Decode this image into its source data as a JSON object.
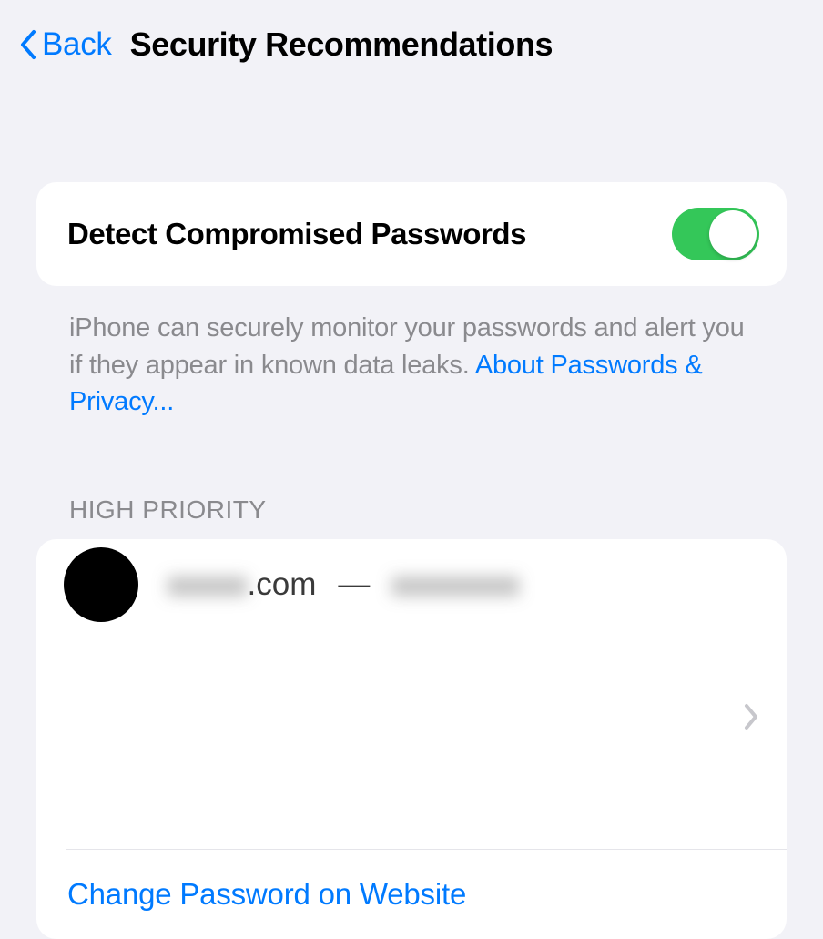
{
  "nav": {
    "back_label": "Back",
    "title": "Security Recommendations"
  },
  "detect_toggle": {
    "label": "Detect Compromised Passwords",
    "enabled": true
  },
  "description": {
    "text": "iPhone can securely monitor your passwords and alert you if they appear in known data leaks. ",
    "link_text": "About Passwords & Privacy..."
  },
  "section_header": "HIGH PRIORITY",
  "item": {
    "site_prefix": "xxxxx",
    "site_domain": ".com",
    "separator": "—",
    "account": "xxxxxxxx"
  },
  "action": {
    "change_password": "Change Password on Website"
  }
}
